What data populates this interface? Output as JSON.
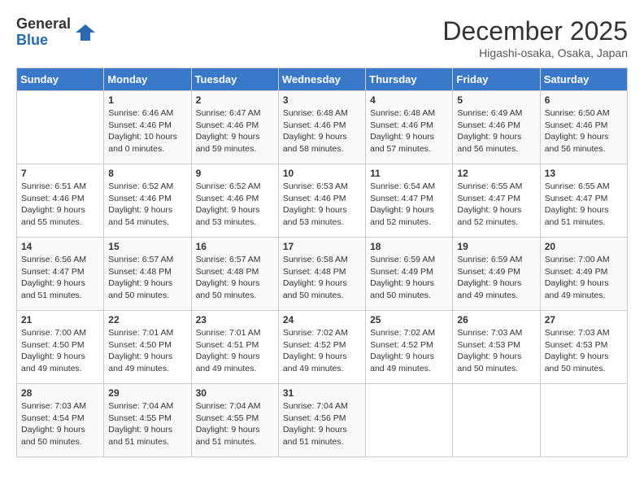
{
  "logo": {
    "general": "General",
    "blue": "Blue"
  },
  "title": "December 2025",
  "location": "Higashi-osaka, Osaka, Japan",
  "days_of_week": [
    "Sunday",
    "Monday",
    "Tuesday",
    "Wednesday",
    "Thursday",
    "Friday",
    "Saturday"
  ],
  "weeks": [
    [
      {
        "day": "",
        "sunrise": "",
        "sunset": "",
        "daylight": ""
      },
      {
        "day": "1",
        "sunrise": "Sunrise: 6:46 AM",
        "sunset": "Sunset: 4:46 PM",
        "daylight": "Daylight: 10 hours and 0 minutes."
      },
      {
        "day": "2",
        "sunrise": "Sunrise: 6:47 AM",
        "sunset": "Sunset: 4:46 PM",
        "daylight": "Daylight: 9 hours and 59 minutes."
      },
      {
        "day": "3",
        "sunrise": "Sunrise: 6:48 AM",
        "sunset": "Sunset: 4:46 PM",
        "daylight": "Daylight: 9 hours and 58 minutes."
      },
      {
        "day": "4",
        "sunrise": "Sunrise: 6:48 AM",
        "sunset": "Sunset: 4:46 PM",
        "daylight": "Daylight: 9 hours and 57 minutes."
      },
      {
        "day": "5",
        "sunrise": "Sunrise: 6:49 AM",
        "sunset": "Sunset: 4:46 PM",
        "daylight": "Daylight: 9 hours and 56 minutes."
      },
      {
        "day": "6",
        "sunrise": "Sunrise: 6:50 AM",
        "sunset": "Sunset: 4:46 PM",
        "daylight": "Daylight: 9 hours and 56 minutes."
      }
    ],
    [
      {
        "day": "7",
        "sunrise": "Sunrise: 6:51 AM",
        "sunset": "Sunset: 4:46 PM",
        "daylight": "Daylight: 9 hours and 55 minutes."
      },
      {
        "day": "8",
        "sunrise": "Sunrise: 6:52 AM",
        "sunset": "Sunset: 4:46 PM",
        "daylight": "Daylight: 9 hours and 54 minutes."
      },
      {
        "day": "9",
        "sunrise": "Sunrise: 6:52 AM",
        "sunset": "Sunset: 4:46 PM",
        "daylight": "Daylight: 9 hours and 53 minutes."
      },
      {
        "day": "10",
        "sunrise": "Sunrise: 6:53 AM",
        "sunset": "Sunset: 4:46 PM",
        "daylight": "Daylight: 9 hours and 53 minutes."
      },
      {
        "day": "11",
        "sunrise": "Sunrise: 6:54 AM",
        "sunset": "Sunset: 4:47 PM",
        "daylight": "Daylight: 9 hours and 52 minutes."
      },
      {
        "day": "12",
        "sunrise": "Sunrise: 6:55 AM",
        "sunset": "Sunset: 4:47 PM",
        "daylight": "Daylight: 9 hours and 52 minutes."
      },
      {
        "day": "13",
        "sunrise": "Sunrise: 6:55 AM",
        "sunset": "Sunset: 4:47 PM",
        "daylight": "Daylight: 9 hours and 51 minutes."
      }
    ],
    [
      {
        "day": "14",
        "sunrise": "Sunrise: 6:56 AM",
        "sunset": "Sunset: 4:47 PM",
        "daylight": "Daylight: 9 hours and 51 minutes."
      },
      {
        "day": "15",
        "sunrise": "Sunrise: 6:57 AM",
        "sunset": "Sunset: 4:48 PM",
        "daylight": "Daylight: 9 hours and 50 minutes."
      },
      {
        "day": "16",
        "sunrise": "Sunrise: 6:57 AM",
        "sunset": "Sunset: 4:48 PM",
        "daylight": "Daylight: 9 hours and 50 minutes."
      },
      {
        "day": "17",
        "sunrise": "Sunrise: 6:58 AM",
        "sunset": "Sunset: 4:48 PM",
        "daylight": "Daylight: 9 hours and 50 minutes."
      },
      {
        "day": "18",
        "sunrise": "Sunrise: 6:59 AM",
        "sunset": "Sunset: 4:49 PM",
        "daylight": "Daylight: 9 hours and 50 minutes."
      },
      {
        "day": "19",
        "sunrise": "Sunrise: 6:59 AM",
        "sunset": "Sunset: 4:49 PM",
        "daylight": "Daylight: 9 hours and 49 minutes."
      },
      {
        "day": "20",
        "sunrise": "Sunrise: 7:00 AM",
        "sunset": "Sunset: 4:49 PM",
        "daylight": "Daylight: 9 hours and 49 minutes."
      }
    ],
    [
      {
        "day": "21",
        "sunrise": "Sunrise: 7:00 AM",
        "sunset": "Sunset: 4:50 PM",
        "daylight": "Daylight: 9 hours and 49 minutes."
      },
      {
        "day": "22",
        "sunrise": "Sunrise: 7:01 AM",
        "sunset": "Sunset: 4:50 PM",
        "daylight": "Daylight: 9 hours and 49 minutes."
      },
      {
        "day": "23",
        "sunrise": "Sunrise: 7:01 AM",
        "sunset": "Sunset: 4:51 PM",
        "daylight": "Daylight: 9 hours and 49 minutes."
      },
      {
        "day": "24",
        "sunrise": "Sunrise: 7:02 AM",
        "sunset": "Sunset: 4:52 PM",
        "daylight": "Daylight: 9 hours and 49 minutes."
      },
      {
        "day": "25",
        "sunrise": "Sunrise: 7:02 AM",
        "sunset": "Sunset: 4:52 PM",
        "daylight": "Daylight: 9 hours and 49 minutes."
      },
      {
        "day": "26",
        "sunrise": "Sunrise: 7:03 AM",
        "sunset": "Sunset: 4:53 PM",
        "daylight": "Daylight: 9 hours and 50 minutes."
      },
      {
        "day": "27",
        "sunrise": "Sunrise: 7:03 AM",
        "sunset": "Sunset: 4:53 PM",
        "daylight": "Daylight: 9 hours and 50 minutes."
      }
    ],
    [
      {
        "day": "28",
        "sunrise": "Sunrise: 7:03 AM",
        "sunset": "Sunset: 4:54 PM",
        "daylight": "Daylight: 9 hours and 50 minutes."
      },
      {
        "day": "29",
        "sunrise": "Sunrise: 7:04 AM",
        "sunset": "Sunset: 4:55 PM",
        "daylight": "Daylight: 9 hours and 51 minutes."
      },
      {
        "day": "30",
        "sunrise": "Sunrise: 7:04 AM",
        "sunset": "Sunset: 4:55 PM",
        "daylight": "Daylight: 9 hours and 51 minutes."
      },
      {
        "day": "31",
        "sunrise": "Sunrise: 7:04 AM",
        "sunset": "Sunset: 4:56 PM",
        "daylight": "Daylight: 9 hours and 51 minutes."
      },
      {
        "day": "",
        "sunrise": "",
        "sunset": "",
        "daylight": ""
      },
      {
        "day": "",
        "sunrise": "",
        "sunset": "",
        "daylight": ""
      },
      {
        "day": "",
        "sunrise": "",
        "sunset": "",
        "daylight": ""
      }
    ]
  ]
}
